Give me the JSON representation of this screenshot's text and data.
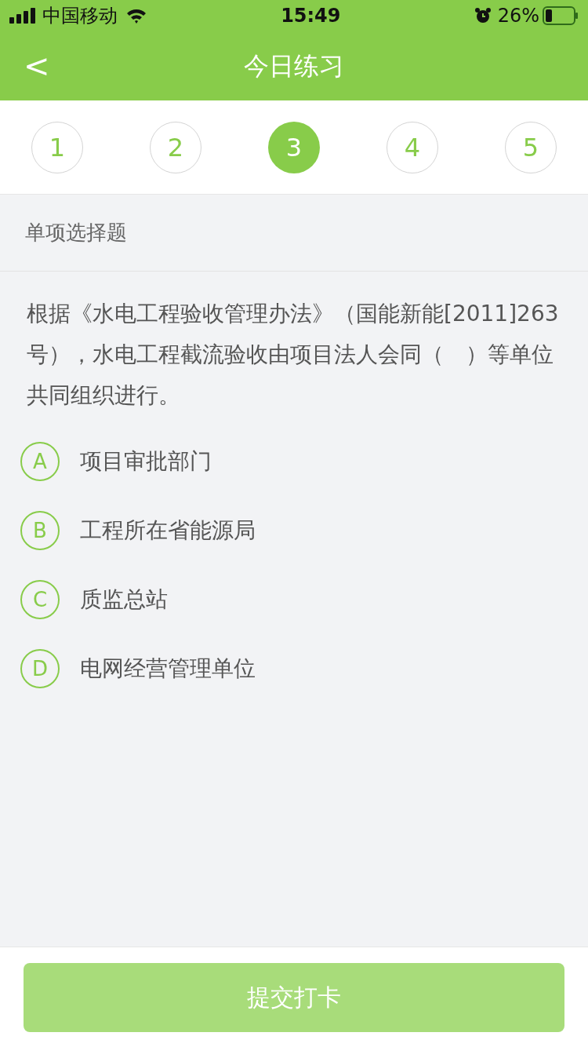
{
  "status_bar": {
    "carrier": "中国移动",
    "time": "15:49",
    "battery": "26%"
  },
  "nav": {
    "back": "<",
    "title": "今日练习"
  },
  "steps": [
    {
      "label": "1",
      "selected": false
    },
    {
      "label": "2",
      "selected": false
    },
    {
      "label": "3",
      "selected": true
    },
    {
      "label": "4",
      "selected": false
    },
    {
      "label": "5",
      "selected": false
    }
  ],
  "section": "单项选择题",
  "question": "根据《水电工程验收管理办法》（国能新能[2011]263号），水电工程截流验收由项目法人会同（　）等单位共同组织进行。",
  "options": [
    {
      "letter": "A",
      "text": "项目审批部门",
      "selected": false
    },
    {
      "letter": "B",
      "text": "工程所在省能源局",
      "selected": false
    },
    {
      "letter": "C",
      "text": "质监总站",
      "selected": false
    },
    {
      "letter": "D",
      "text": "电网经营管理单位",
      "selected": false
    }
  ],
  "submit": {
    "label": "提交打卡",
    "disabled": true
  }
}
